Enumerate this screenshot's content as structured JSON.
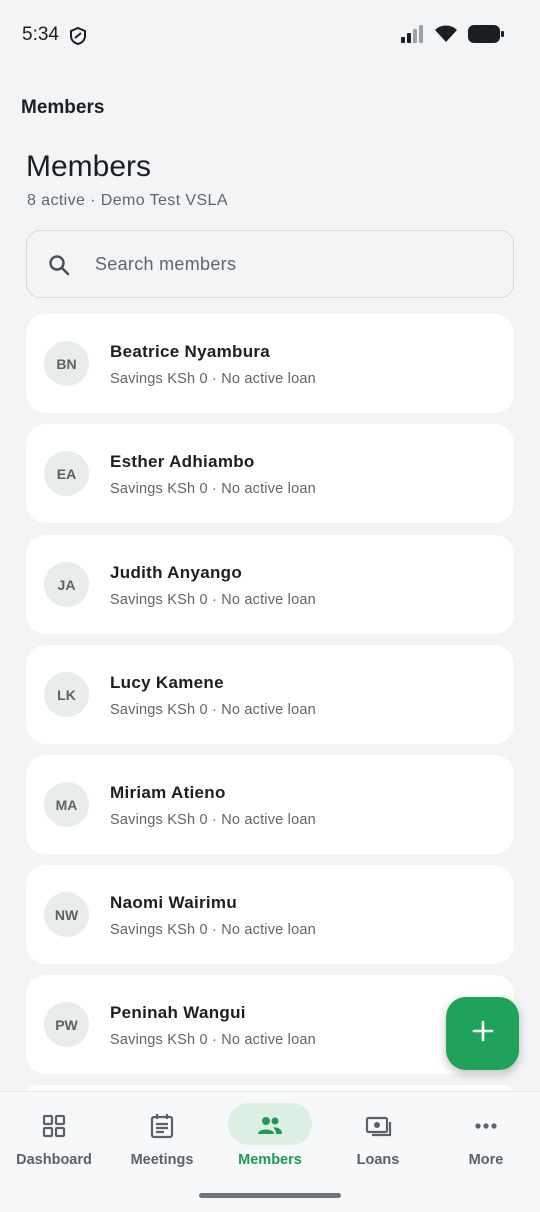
{
  "status_bar": {
    "time": "5:34"
  },
  "app_bar": {
    "title": "Members"
  },
  "header": {
    "title": "Members",
    "subtitle": "8 active · Demo Test VSLA"
  },
  "search": {
    "placeholder": "Search members",
    "value": ""
  },
  "members": [
    {
      "initials": "BN",
      "name": "Beatrice Nyambura",
      "meta": "Savings KSh 0 · No active loan"
    },
    {
      "initials": "EA",
      "name": "Esther Adhiambo",
      "meta": "Savings KSh 0 · No active loan"
    },
    {
      "initials": "JA",
      "name": "Judith Anyango",
      "meta": "Savings KSh 0 · No active loan"
    },
    {
      "initials": "LK",
      "name": "Lucy Kamene",
      "meta": "Savings KSh 0 · No active loan"
    },
    {
      "initials": "MA",
      "name": "Miriam Atieno",
      "meta": "Savings KSh 0 · No active loan"
    },
    {
      "initials": "NW",
      "name": "Naomi Wairimu",
      "meta": "Savings KSh 0 · No active loan"
    },
    {
      "initials": "PW",
      "name": "Peninah Wangui",
      "meta": "Savings KSh 0 · No active loan"
    }
  ],
  "fab": {
    "icon": "plus-icon"
  },
  "nav": {
    "items": [
      {
        "label": "Dashboard",
        "icon": "dashboard-icon"
      },
      {
        "label": "Meetings",
        "icon": "calendar-icon"
      },
      {
        "label": "Members",
        "icon": "people-icon",
        "active": true
      },
      {
        "label": "Loans",
        "icon": "money-icon"
      },
      {
        "label": "More",
        "icon": "more-icon"
      }
    ]
  },
  "colors": {
    "accent": "#1fa35a",
    "accent_text": "#1f9a55",
    "background": "#f2f4f5",
    "card": "#ffffff",
    "avatar_bg": "#e8eceb"
  }
}
